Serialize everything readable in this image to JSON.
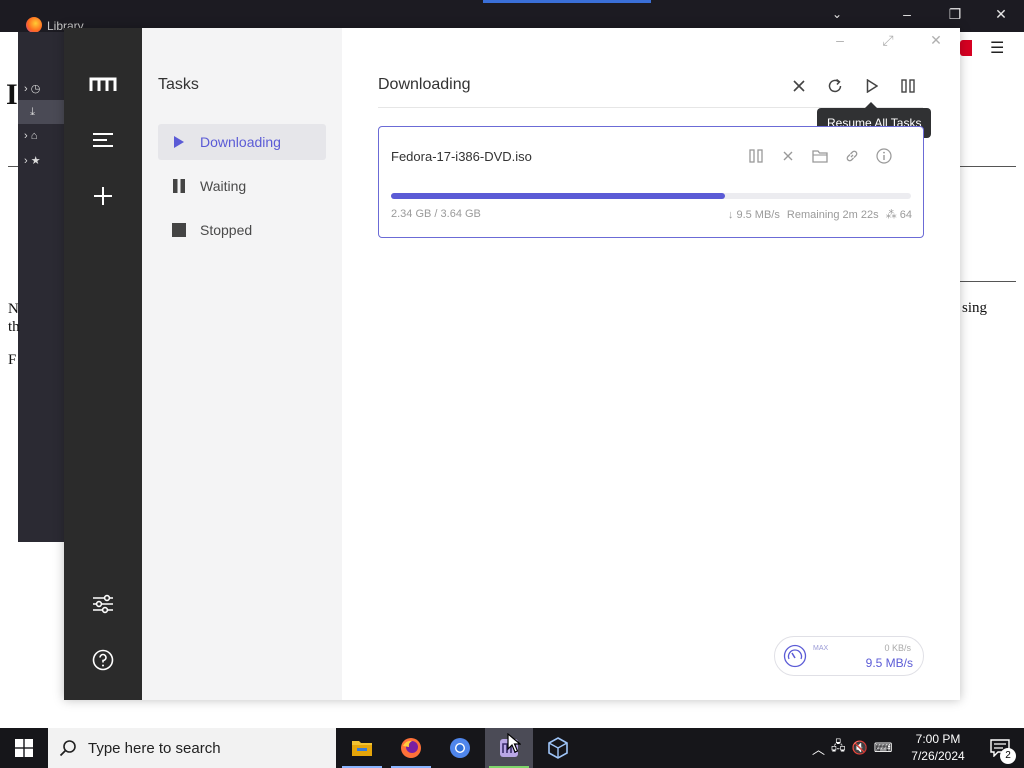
{
  "background": {
    "library_title": "Library",
    "text_right": "sing",
    "text_left_1": "N",
    "text_left_2": "th",
    "text_left_3": "F",
    "big_letter": "I"
  },
  "app": {
    "rail": {
      "logo_icon": "motrix-logo-icon",
      "menu_icon": "menu-lines-icon",
      "add_icon": "plus-icon",
      "settings_icon": "sliders-icon",
      "help_icon": "help-circle-icon"
    },
    "sidebar": {
      "title": "Tasks",
      "items": [
        {
          "label": "Downloading",
          "icon": "play-icon",
          "active": true
        },
        {
          "label": "Waiting",
          "icon": "pause-icon",
          "active": false
        },
        {
          "label": "Stopped",
          "icon": "stop-icon",
          "active": false
        }
      ]
    },
    "main": {
      "title": "Downloading",
      "tooltip": "Resume All Tasks"
    },
    "task": {
      "name": "Fedora-17-i386-DVD.iso",
      "size": "2.34 GB / 3.64 GB",
      "progress": 0.643,
      "speed": "↓ 9.5 MB/s",
      "remaining": "Remaining 2m 22s",
      "connections": "⁂ 64"
    },
    "speedometer": {
      "max_label": "MAX",
      "upload": "0 KB/s",
      "download": "9.5 MB/s"
    }
  },
  "taskbar": {
    "search_placeholder": "Type here to search",
    "time": "7:00 PM",
    "date": "7/26/2024",
    "notification_count": "2"
  },
  "colors": {
    "accent": "#5b5bd6",
    "rail": "#2b2b2b",
    "sidebar": "#f4f4f5",
    "taskbar": "#16161a"
  }
}
